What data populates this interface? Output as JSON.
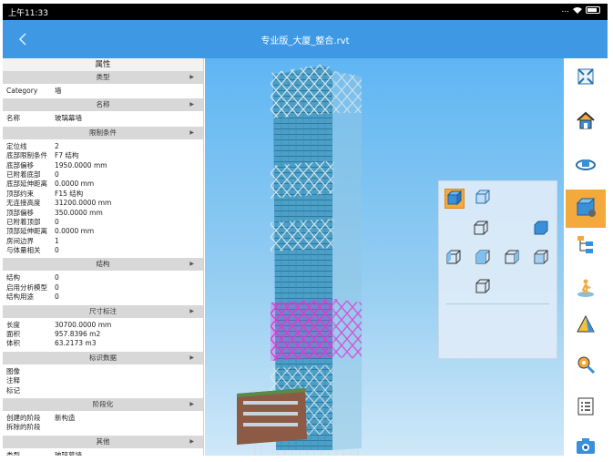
{
  "statusbar": {
    "time": "上午11:33",
    "indicators": "..."
  },
  "appbar": {
    "back_icon": "chevron-left-icon",
    "title": "专业版_大厦_整合.rvt"
  },
  "properties": {
    "title": "属性",
    "sections": [
      {
        "label": "类型",
        "rows": [
          {
            "k": "Category",
            "v": "墙"
          }
        ]
      },
      {
        "label": "名称",
        "rows": [
          {
            "k": "名称",
            "v": "玻璃幕墙"
          }
        ]
      },
      {
        "label": "限制条件",
        "rows": [
          {
            "k": "定位线",
            "v": "2"
          },
          {
            "k": "底部限制条件",
            "v": "F7  结构"
          },
          {
            "k": "底部偏移",
            "v": "1950.0000 mm"
          },
          {
            "k": "已附着底部",
            "v": "0"
          },
          {
            "k": "底部延伸距离",
            "v": "0.0000 mm"
          },
          {
            "k": "顶部约束",
            "v": "F15 结构"
          },
          {
            "k": "无连接高度",
            "v": "31200.0000 mm"
          },
          {
            "k": "顶部偏移",
            "v": "350.0000 mm"
          },
          {
            "k": "已附着顶部",
            "v": "0"
          },
          {
            "k": "顶部延伸距离",
            "v": "0.0000 mm"
          },
          {
            "k": "房间边界",
            "v": "1"
          },
          {
            "k": "与体量相关",
            "v": "0"
          }
        ]
      },
      {
        "label": "结构",
        "rows": [
          {
            "k": "结构",
            "v": "0"
          },
          {
            "k": "启用分析模型",
            "v": "0"
          },
          {
            "k": "结构用途",
            "v": "0"
          }
        ]
      },
      {
        "label": "尺寸标注",
        "rows": [
          {
            "k": "长度",
            "v": "30700.0000 mm"
          },
          {
            "k": "面积",
            "v": "957.8396 m2"
          },
          {
            "k": "体积",
            "v": "63.2173 m3"
          }
        ]
      },
      {
        "label": "标识数据",
        "rows": [
          {
            "k": "图像",
            "v": ""
          },
          {
            "k": "注释",
            "v": ""
          },
          {
            "k": "标记",
            "v": ""
          }
        ]
      },
      {
        "label": "阶段化",
        "rows": [
          {
            "k": "创建的阶段",
            "v": "新构造"
          },
          {
            "k": "拆除的阶段",
            "v": ""
          }
        ]
      },
      {
        "label": "其他",
        "rows": [
          {
            "k": "类型",
            "v": "玻璃幕墙"
          },
          {
            "k": "族与类型",
            "v": "玻璃幕墙"
          }
        ]
      }
    ]
  },
  "view_cube_panel": {
    "options": [
      "shaded-cube-icon",
      "wireframe-cube-icon",
      "view-front-icon",
      "view-back-icon",
      "view-left-icon",
      "view-top-icon",
      "view-right-icon",
      "view-iso-icon",
      "view-bottom-icon"
    ],
    "selected": "shaded-cube-icon"
  },
  "toolbar": {
    "tools": [
      "fit-view-icon",
      "home-icon",
      "orbit-icon",
      "view-cube-icon",
      "model-tree-icon",
      "walk-icon",
      "section-box-icon",
      "measure-icon",
      "properties-list-icon",
      "screenshot-icon"
    ],
    "active": "view-cube-icon"
  },
  "colors": {
    "appbar": "#3f98e4",
    "accent": "#f3a93b",
    "selection": "#e238d8"
  }
}
